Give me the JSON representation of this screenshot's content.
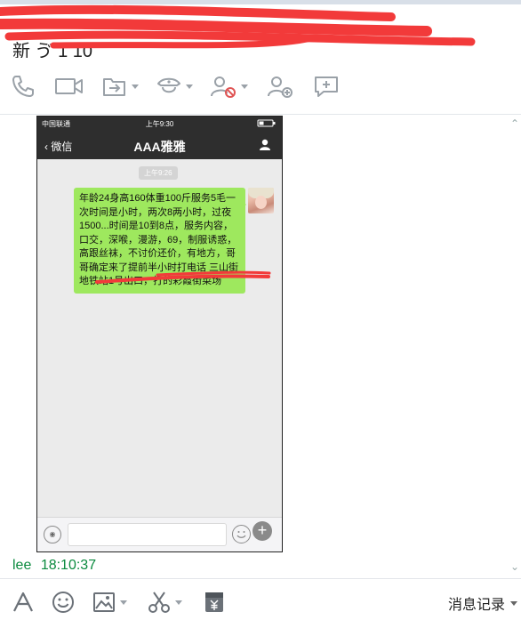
{
  "header": {
    "title": "新 ゔ 1 10"
  },
  "toolbar": {
    "items": [
      {
        "icon": "phone-icon"
      },
      {
        "icon": "video-icon"
      },
      {
        "icon": "file-transfer-icon"
      },
      {
        "icon": "remote-control-icon"
      },
      {
        "icon": "block-user-icon"
      },
      {
        "icon": "add-user-icon"
      },
      {
        "icon": "message-icon"
      }
    ]
  },
  "phone": {
    "status": {
      "carrier": "中国联通",
      "time": "上午9:30"
    },
    "nav": {
      "back_label": "微信",
      "title": "AAA雅雅"
    },
    "message_time": "上午9:26",
    "message_text": "年龄24身高160体重100斤服务5毛一次时间是小时，两次8两小时，过夜1500...时间是10到8点，服务内容，口交，深喉，漫游，69，制服诱惑，高跟丝袜，不讨价还价，有地方，哥哥确定来了提前半小时打电话                三山街地铁站1号出口，打的彩霞街菜场"
  },
  "sender": {
    "name": "lee",
    "time": "18:10:37"
  },
  "bottom_toolbar": {
    "history_label": "消息记录"
  },
  "colors": {
    "bubble": "#9ee85e",
    "phone_bar": "#2e2e2e",
    "sender": "#0a8a3e",
    "redaction": "#f23a3a"
  }
}
